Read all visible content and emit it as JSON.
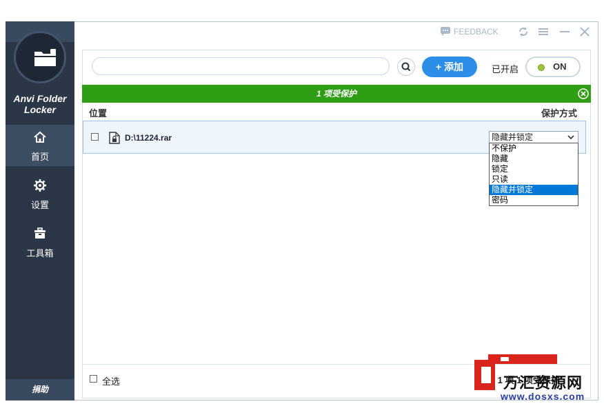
{
  "titlebar": {
    "feedback_label": "FEEDBACK"
  },
  "sidebar": {
    "app_name_line1": "Anvi Folder",
    "app_name_line2": "Locker",
    "items": [
      {
        "label": "首页",
        "icon": "home-icon",
        "active": true
      },
      {
        "label": "设置",
        "icon": "gear-icon",
        "active": false
      },
      {
        "label": "工具箱",
        "icon": "toolbox-icon",
        "active": false
      }
    ],
    "donate_label": "捐助"
  },
  "toolbar": {
    "search_placeholder": "",
    "search_value": "",
    "add_label": "+ 添加",
    "status_label": "已开启",
    "toggle_label": "ON"
  },
  "banner": {
    "text": "1 项受保护"
  },
  "table": {
    "columns": [
      "位置",
      "保护方式"
    ],
    "rows": [
      {
        "path": "D:\\11224.rar",
        "protection": "隐藏并锁定",
        "checked": false
      }
    ]
  },
  "dropdown": {
    "options": [
      "不保护",
      "隐藏",
      "锁定",
      "只读",
      "隐藏并锁定",
      "密码"
    ],
    "selected": "隐藏并锁定"
  },
  "footer": {
    "select_all_label": "全选",
    "summary_text": "总 1 项 1 项受保护"
  },
  "watermark": {
    "main": "万汇资源网",
    "url": "www.dosxs.com"
  },
  "colors": {
    "sidebar_bg": "#2b3646",
    "accent_blue": "#2d8ee8",
    "banner_green": "#2f9e14",
    "selection_blue": "#0078d7"
  }
}
